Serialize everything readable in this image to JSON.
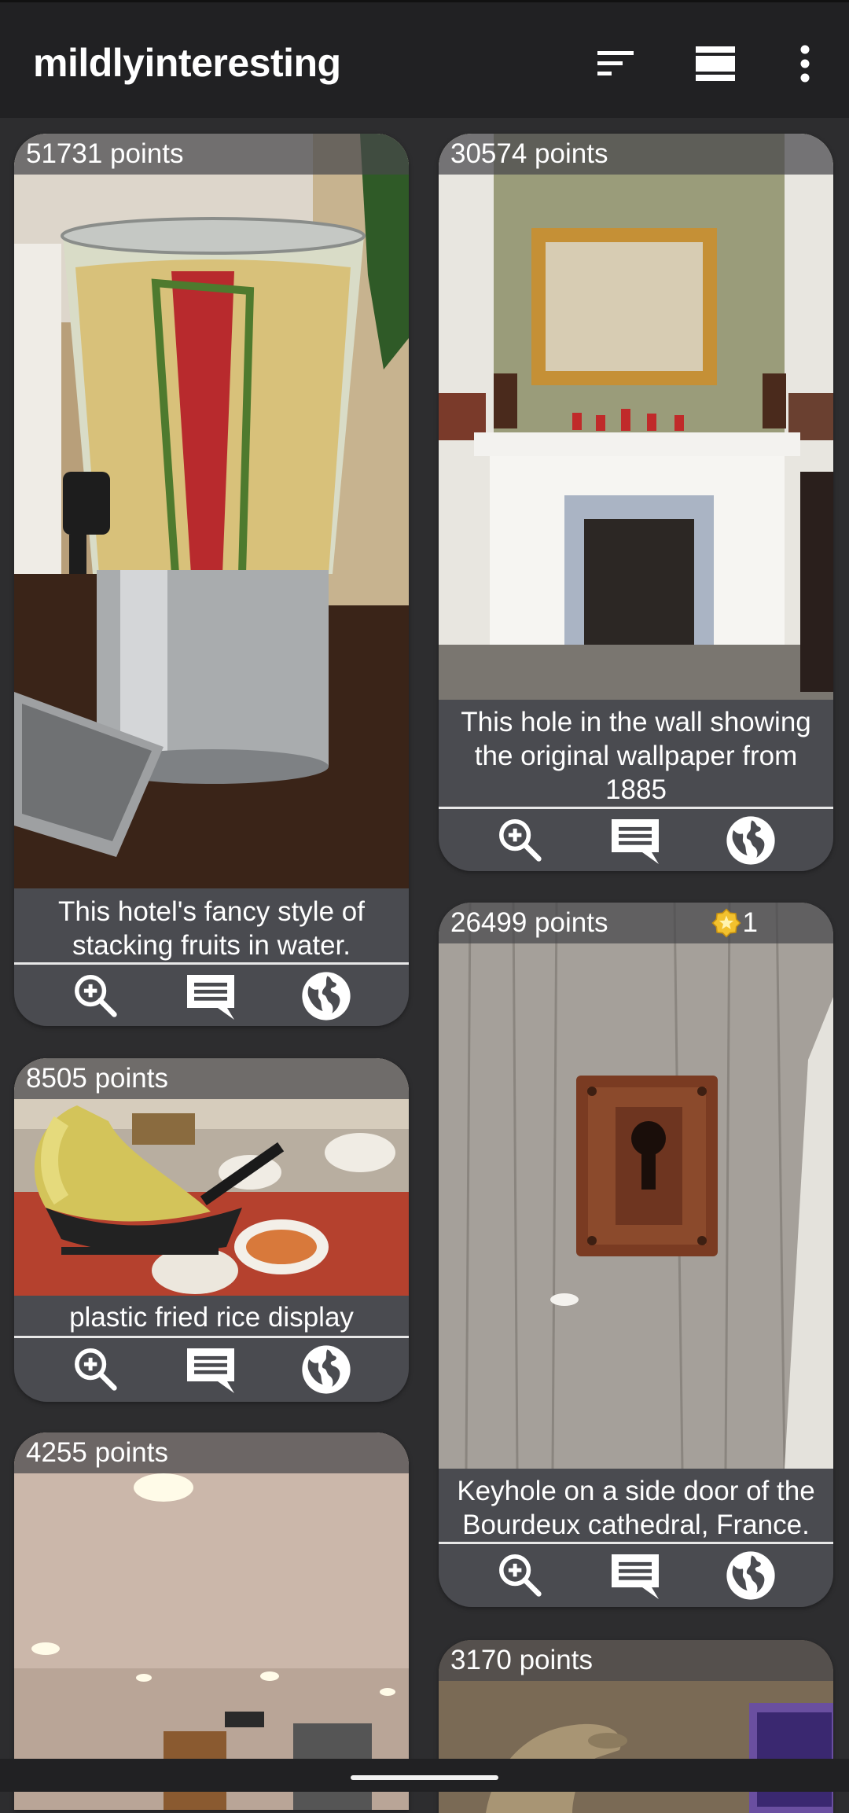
{
  "app": {
    "title": "mildlyinteresting",
    "icons": [
      "sort-icon",
      "view-mode-icon",
      "more-vert-icon"
    ]
  },
  "colors": {
    "background": "#2d2d2f",
    "appbar": "#212123",
    "card": "#4a4b50",
    "text": "#ffffff",
    "award": "#f2c12e"
  },
  "posts": [
    {
      "points": "51731 points",
      "caption": "This hotel's fancy style of stacking fruits in water."
    },
    {
      "points": "30574 points",
      "caption": "This hole in the wall showing the original wallpaper from 1885"
    },
    {
      "points": "8505 points",
      "caption": "plastic fried rice display"
    },
    {
      "points": "26499 points",
      "caption": "Keyhole on a side door of the Bourdeux cathedral, France.",
      "award_count": "1"
    },
    {
      "points": "4255 points"
    },
    {
      "points": "3170 points"
    }
  ],
  "actions": [
    "zoom-in-icon",
    "comment-icon",
    "globe-icon"
  ]
}
